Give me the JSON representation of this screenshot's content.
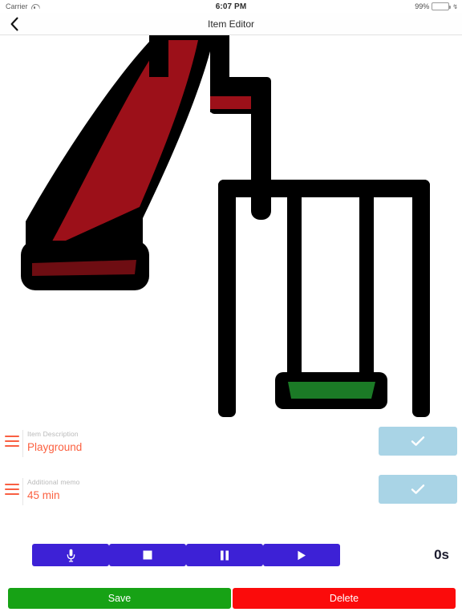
{
  "status_bar": {
    "carrier": "Carrier",
    "wifi_icon": "wifi-icon",
    "time": "6:07 PM",
    "battery_percent": "99%",
    "battery_icon": "battery-icon",
    "battery_bolt": "↯",
    "battery_level": 99,
    "battery_color": "#4cd25f"
  },
  "nav_bar": {
    "back_icon": "chevron-left-icon",
    "title": "Item Editor"
  },
  "illustration": {
    "name": "playground-illustration",
    "alt": "Playground with red slide and green swing",
    "colors": {
      "outline": "#000000",
      "slide_red": "#9c1019",
      "slide_red_dark": "#6e0d12",
      "swing_green": "#1b7a26",
      "background": "#ffffff"
    }
  },
  "fields": [
    {
      "reorder_icon": "reorder-handle-icon",
      "label": "Item Description",
      "value": "Playground",
      "confirm_icon": "check-icon"
    },
    {
      "reorder_icon": "reorder-handle-icon",
      "label": "Additional memo",
      "value": "45 min",
      "confirm_icon": "check-icon"
    }
  ],
  "media_controls": {
    "buttons": [
      {
        "name": "record-button",
        "icon": "microphone-icon"
      },
      {
        "name": "stop-button",
        "icon": "stop-square-icon"
      },
      {
        "name": "pause-button",
        "icon": "pause-bars-icon"
      },
      {
        "name": "play-button",
        "icon": "play-triangle-icon"
      }
    ],
    "timer": "0s",
    "button_color": "#3d21d6"
  },
  "bottom_actions": {
    "save_label": "Save",
    "save_color": "#17a215",
    "delete_label": "Delete",
    "delete_color": "#fb0b0b"
  },
  "theme": {
    "accent": "#fb6141",
    "confirm_button": "#a9d4e6",
    "label_gray": "#b9b9b9"
  }
}
